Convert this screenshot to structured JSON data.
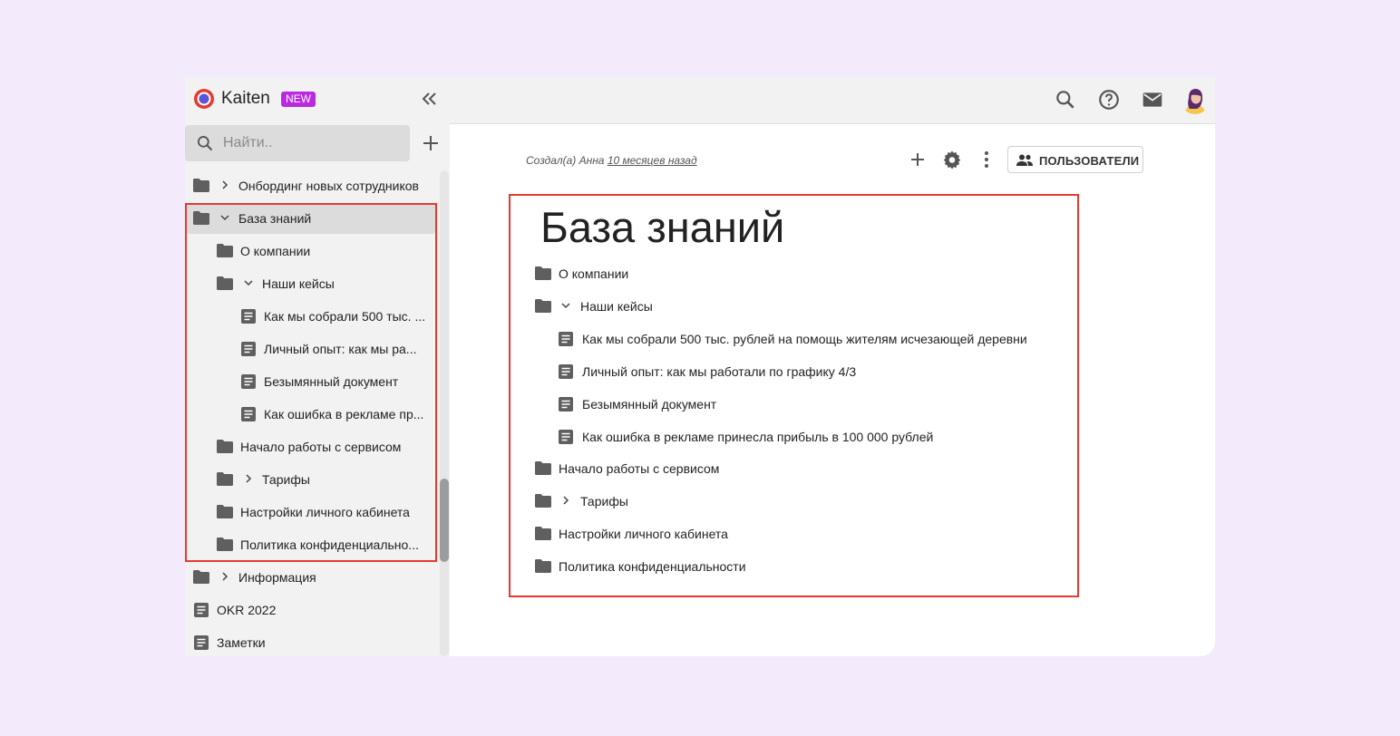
{
  "app": {
    "name": "Kaiten",
    "badge": "NEW",
    "search_placeholder": "Найти.."
  },
  "sidebar": {
    "items": [
      {
        "label": "Онбординг новых сотрудников"
      },
      {
        "label": "База знаний"
      },
      {
        "label": "О компании"
      },
      {
        "label": "Наши кейсы"
      },
      {
        "label": "Как мы собрали 500 тыс. ..."
      },
      {
        "label": "Личный опыт: как мы ра..."
      },
      {
        "label": "Безымянный документ"
      },
      {
        "label": "Как ошибка в рекламе пр..."
      },
      {
        "label": "Начало работы с сервисом"
      },
      {
        "label": "Тарифы"
      },
      {
        "label": "Настройки личного кабинета"
      },
      {
        "label": "Политика конфиденциально..."
      },
      {
        "label": "Информация"
      },
      {
        "label": "OKR 2022"
      },
      {
        "label": "Заметки"
      }
    ]
  },
  "page": {
    "created_by": "Создал(а) Анна",
    "created_when": "10 месяцев назад",
    "users_button": "ПОЛЬЗОВАТЕЛИ",
    "title": "База знаний",
    "items": [
      {
        "label": "О компании"
      },
      {
        "label": "Наши кейсы"
      },
      {
        "label": "Как мы собрали 500 тыс. рублей на помощь жителям исчезающей деревни"
      },
      {
        "label": "Личный опыт: как мы работали по графику 4/3"
      },
      {
        "label": "Безымянный документ"
      },
      {
        "label": "Как ошибка в рекламе принесла прибыль в 100 000 рублей"
      },
      {
        "label": "Начало работы с сервисом"
      },
      {
        "label": "Тарифы"
      },
      {
        "label": "Настройки личного кабинета"
      },
      {
        "label": "Политика конфиденциальности"
      }
    ]
  },
  "colors": {
    "accent": "#b92ae0",
    "highlight": "#e8392e",
    "background": "#f3eafc"
  }
}
